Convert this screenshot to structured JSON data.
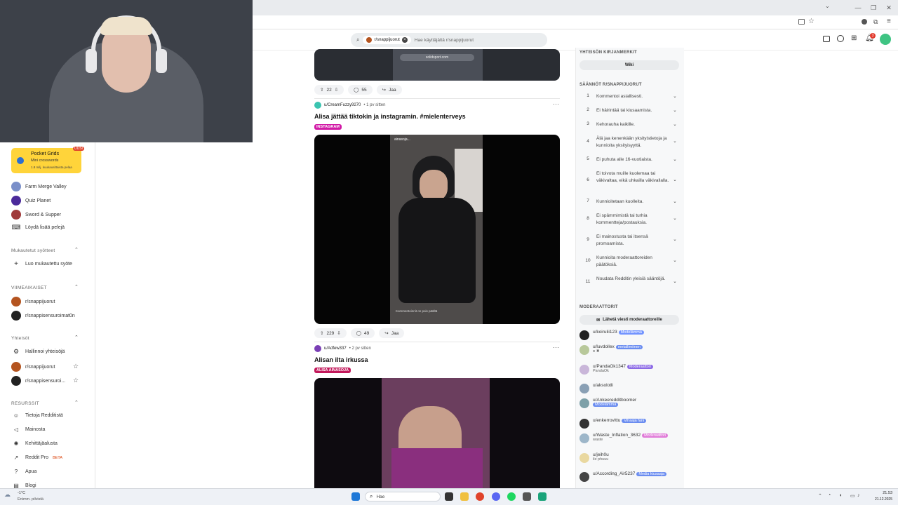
{
  "browser": {
    "tab_menu_icon": "chevron-down-icon",
    "win_controls": [
      "—",
      "❐",
      "✕"
    ]
  },
  "header": {
    "subreddit_chip": "r/snappijuorut",
    "search_placeholder": "Hae käyttäjältä r/snappijuorut",
    "notification_count": "3"
  },
  "left_nav": {
    "promo": {
      "title": "Pocket Grids",
      "subtitle": "Mini crosswords",
      "meta": "1.8 milj. kuukausittaista pelaa",
      "badge": "UUSI"
    },
    "games": [
      "Farm Merge Valley",
      "Quiz Planet",
      "Sword & Supper",
      "Löydä lisää pelejä"
    ],
    "custom_feeds_header": "Mukautetut syötteet",
    "create_feed": "Luo mukautettu syöte",
    "recent_header": "VIIMEAIKAISET",
    "recent": [
      "r/snappijuorut",
      "r/snappisensuroimat0n"
    ],
    "communities_header": "Yhteisöt",
    "communities": [
      "Hallinnoi yhteisöjä",
      "r/snappijuorut",
      "r/snappisensuroi..."
    ],
    "resources_header": "RESURSSIT",
    "resources": [
      "Tietoja Redditistä",
      "Mainosta",
      "Kehittäjäalusta",
      "Reddit Pro",
      "Apua",
      "Blogi"
    ],
    "pro_badge": "BETA"
  },
  "feed": {
    "post0": {
      "votes": "22",
      "comments": "55",
      "share": "Jaa",
      "url_text": "solidsport.com"
    },
    "post1": {
      "author": "u/CreamFuzzy9270",
      "time": "• 1 pv sitten",
      "title": "Alisa jättää tiktokin ja instagramin. #mielenterveys",
      "flair": "INSTAGRAM",
      "votes": "229",
      "comments": "49",
      "share": "Jaa",
      "story_user": "ainasoja...",
      "story_caption": "Kommentoinnit on pois päältä"
    },
    "post2": {
      "author": "u/Adfew337",
      "time": "• 2 pv sitten",
      "title": "Alisan ilta irkussa",
      "flair": "ALISA AINASOJA"
    }
  },
  "sidebar": {
    "bookmarks_header": "YHTEISÖN KIRJANMERKIT",
    "wiki": "Wiki",
    "rules_header": "SÄÄNNÖT R/SNAPPIJUORUT",
    "rules": [
      {
        "n": "1",
        "t": "Kommentoi asiallisesti."
      },
      {
        "n": "2",
        "t": "Ei häirintää tai kiusaamista."
      },
      {
        "n": "3",
        "t": "Kehorauha kaikille."
      },
      {
        "n": "4",
        "t": "Älä jaa kenenkään yksityistietoja ja kunnioita yksityisyyttä."
      },
      {
        "n": "5",
        "t": "Ei puhuta alle 16-vuotiaista."
      },
      {
        "n": "6",
        "t": "Ei toivota muille kuolemaa tai väkivaltaa, eikä uhkailla väkivallalla."
      },
      {
        "n": "7",
        "t": "Kunnioitetaan kuolleita."
      },
      {
        "n": "8",
        "t": "Ei spämmimistä tai turhia kommentteja/postauksia."
      },
      {
        "n": "9",
        "t": "Ei mainostusta tai itsensä promoamista."
      },
      {
        "n": "10",
        "t": "Kunnioita moderaattoreiden päätöksiä."
      },
      {
        "n": "11",
        "t": "Noudata Redditin yleisiä sääntöjä."
      }
    ],
    "moderators_header": "MODERAATTORIT",
    "message_mods": "Lähetä viesti moderaattoreille",
    "mods": [
      {
        "name": "u/koirulii123",
        "badge": "Modelämmä",
        "color": "#7193ff",
        "sub": ""
      },
      {
        "name": "u/luvdollex",
        "badge": "metallimiinen",
        "color": "#6a8cf0",
        "sub": ""
      },
      {
        "name": "u/PandaOk1347",
        "badge": "Moderaattori",
        "color": "#8c6ae6",
        "sub": "PandaOk"
      },
      {
        "name": "u/aksolotli",
        "badge": "",
        "color": "",
        "sub": ""
      },
      {
        "name": "u/Ankeeredditboomer",
        "badge": "Modelämmä",
        "color": "#6a8cf0",
        "sub": ""
      },
      {
        "name": "u/enkerrovittu",
        "badge": "Vihaaja fani",
        "color": "#6a8cf0",
        "sub": ""
      },
      {
        "name": "u/Waste_Inflation_3632",
        "badge": "Moderaattori",
        "color": "#e07ad8",
        "sub": "waste"
      },
      {
        "name": "u/jeih0u",
        "badge": "",
        "color": "",
        "sub": "ile phuuu"
      },
      {
        "name": "u/According_Air5237",
        "badge": "Media kiusaaja",
        "color": "#6a8cf0",
        "sub": ""
      }
    ]
  },
  "taskbar": {
    "weather_temp": "-1°C",
    "weather_desc": "Enimm. pilvistä",
    "search": "Hae",
    "time": "21.53",
    "date": "21.12.2025"
  }
}
